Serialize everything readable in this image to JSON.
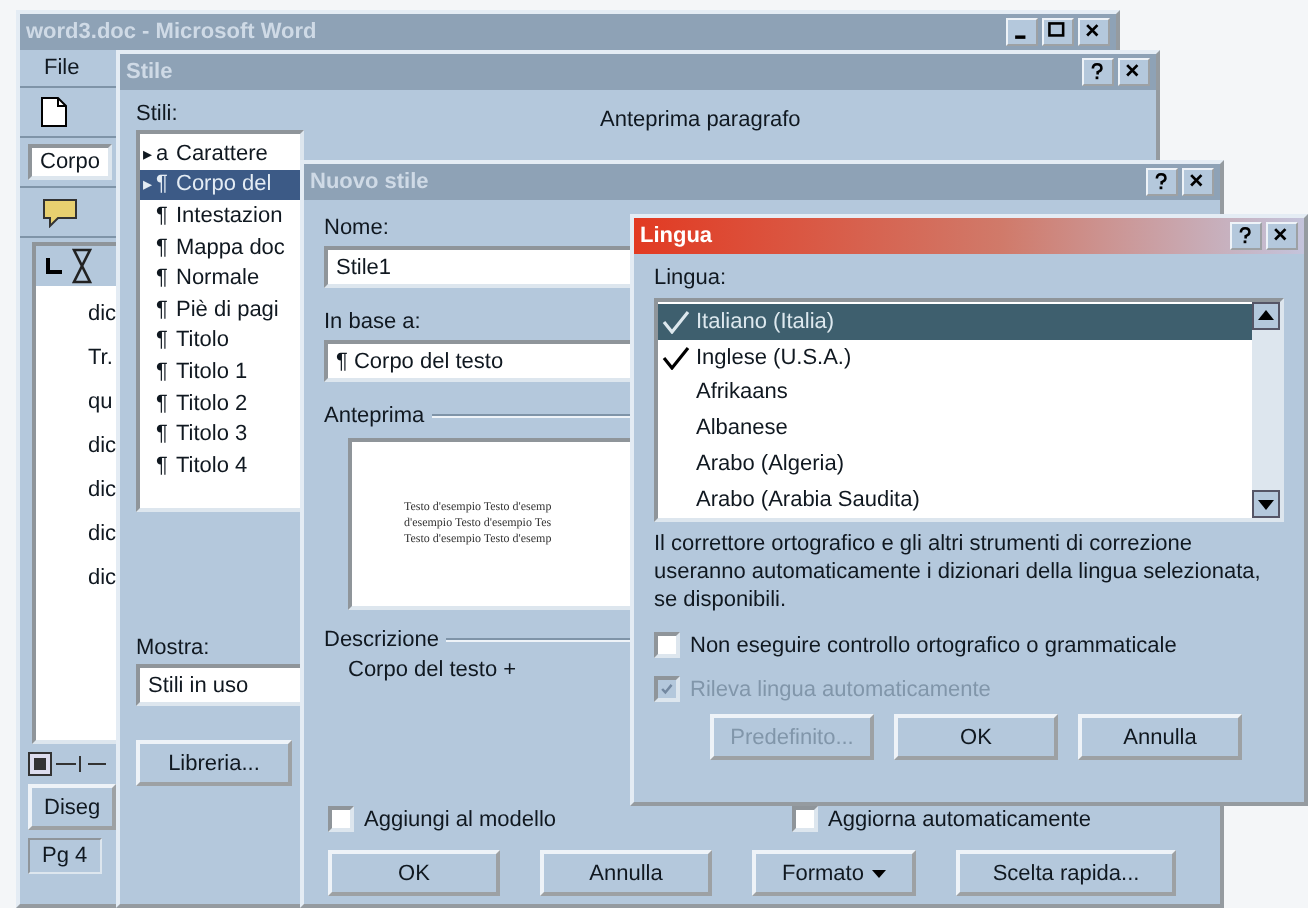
{
  "word_window": {
    "title": "word3.doc - Microsoft Word",
    "active": false,
    "menu": [
      "File"
    ],
    "style_box": "Corpo",
    "document_lines": [
      "dic",
      "Tr.",
      "qu",
      "dic",
      "dic",
      "dic",
      "dic"
    ],
    "drawing_toolbar": "Diseg",
    "status_bar": "Pg 4"
  },
  "styles_dialog": {
    "title": "Stile",
    "active": false,
    "styles_label": "Stili:",
    "styles": [
      {
        "arrow": "▸",
        "mark": "a",
        "label": "Carattere",
        "selected": false
      },
      {
        "arrow": "▸",
        "mark": "¶",
        "label": "Corpo del",
        "selected": true
      },
      {
        "mark": "¶",
        "label": "Intestazion",
        "selected": false
      },
      {
        "mark": "¶",
        "label": "Mappa doc",
        "selected": false
      },
      {
        "mark": "¶",
        "label": "Normale",
        "selected": false
      },
      {
        "mark": "¶",
        "label": "Piè di pagi",
        "selected": false
      },
      {
        "mark": "¶",
        "label": "Titolo",
        "selected": false
      },
      {
        "mark": "¶",
        "label": "Titolo 1",
        "selected": false
      },
      {
        "mark": "¶",
        "label": "Titolo 2",
        "selected": false
      },
      {
        "mark": "¶",
        "label": "Titolo 3",
        "selected": false
      },
      {
        "mark": "¶",
        "label": "Titolo 4",
        "selected": false
      }
    ],
    "preview_label": "Anteprima paragrafo",
    "show_label": "Mostra:",
    "show_value": "Stili in uso",
    "library_button": "Libreria..."
  },
  "new_style_dialog": {
    "title": "Nuovo stile",
    "active": false,
    "name_label": "Nome:",
    "name_value": "Stile1",
    "based_on_label": "In base a:",
    "based_on_value": "¶ Corpo del testo",
    "preview_label": "Anteprima",
    "preview_lines": [
      "Testo d'esempio Testo d'esemp",
      "d'esempio Testo d'esempio Tes",
      "Testo d'esempio Testo d'esemp"
    ],
    "description_label": "Descrizione",
    "description": "Corpo del testo +",
    "checkboxes": [
      {
        "label": "Aggiungi al modello",
        "checked": false
      },
      {
        "label": "Aggiorna automaticamente",
        "checked": false
      }
    ],
    "buttons": [
      {
        "label": "OK",
        "dropdown": false
      },
      {
        "label": "Annulla",
        "dropdown": false
      },
      {
        "label": "Formato",
        "dropdown": true
      },
      {
        "label": "Scelta rapida...",
        "dropdown": false
      }
    ]
  },
  "language_dialog": {
    "title": "Lingua",
    "active": true,
    "list_label": "Lingua:",
    "languages": [
      {
        "label": "Italiano (Italia)",
        "spellcheck": true,
        "selected": true
      },
      {
        "label": "Inglese (U.S.A.)",
        "spellcheck": true,
        "selected": false
      },
      {
        "label": "Afrikaans",
        "spellcheck": false,
        "selected": false
      },
      {
        "label": "Albanese",
        "spellcheck": false,
        "selected": false
      },
      {
        "label": "Arabo (Algeria)",
        "spellcheck": false,
        "selected": false
      },
      {
        "label": "Arabo (Arabia Saudita)",
        "spellcheck": false,
        "selected": false
      }
    ],
    "note": "Il correttore ortografico e gli altri strumenti di correzione useranno automaticamente i dizionari della lingua selezionata, se disponibili.",
    "checkboxes": [
      {
        "label": "Non eseguire controllo ortografico o grammaticale",
        "checked": false,
        "disabled": false
      },
      {
        "label": "Rileva lingua automaticamente",
        "checked": true,
        "disabled": true
      }
    ],
    "buttons": [
      {
        "label": "Predefinito...",
        "disabled": true
      },
      {
        "label": "OK",
        "disabled": false
      },
      {
        "label": "Annulla",
        "disabled": false
      }
    ]
  }
}
